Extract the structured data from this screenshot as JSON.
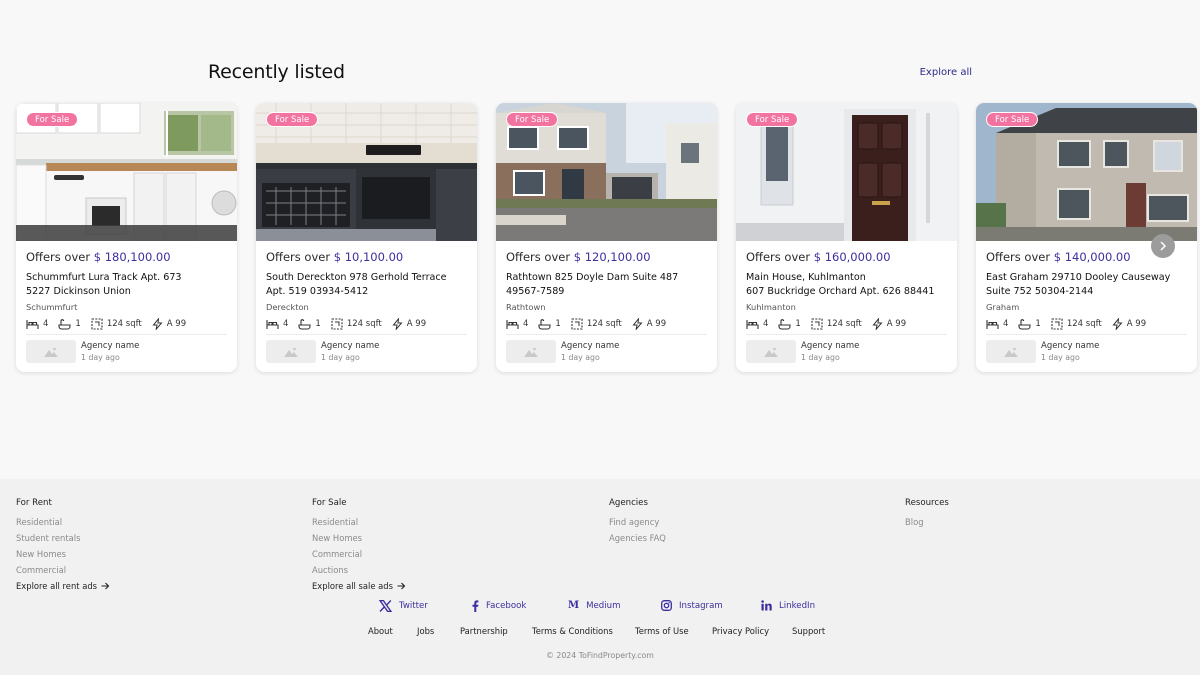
{
  "section": {
    "title": "Recently listed",
    "explore_label": "Explore all"
  },
  "listings": [
    {
      "badge": "For Sale",
      "price_prefix": "Offers over",
      "price": "$ 180,100.00",
      "address_line1": "Schummfurt Lura Track Apt. 673",
      "address_line2": "5227 Dickinson Union",
      "town": "Schummfurt",
      "beds": "4",
      "baths": "1",
      "area": "124 sqft",
      "energy": "A 99",
      "agency_name": "Agency name",
      "listed": "1 day ago"
    },
    {
      "badge": "For Sale",
      "price_prefix": "Offers over",
      "price": "$ 10,100.00",
      "address_line1": "South Dereckton 978 Gerhold Terrace",
      "address_line2": "Apt. 519 03934-5412",
      "town": "Dereckton",
      "beds": "4",
      "baths": "1",
      "area": "124 sqft",
      "energy": "A 99",
      "agency_name": "Agency name",
      "listed": "1 day ago"
    },
    {
      "badge": "For Sale",
      "price_prefix": "Offers over",
      "price": "$ 120,100.00",
      "address_line1": "Rathtown 825 Doyle Dam Suite 487",
      "address_line2": "49567-7589",
      "town": "Rathtown",
      "beds": "4",
      "baths": "1",
      "area": "124 sqft",
      "energy": "A 99",
      "agency_name": "Agency name",
      "listed": "1 day ago"
    },
    {
      "badge": "For Sale",
      "price_prefix": "Offers over",
      "price": "$ 160,000.00",
      "address_line1": "Main House, Kuhlmanton",
      "address_line2": "607 Buckridge Orchard Apt. 626 88441",
      "town": "Kuhlmanton",
      "beds": "4",
      "baths": "1",
      "area": "124 sqft",
      "energy": "A 99",
      "agency_name": "Agency name",
      "listed": "1 day ago"
    },
    {
      "badge": "For Sale",
      "price_prefix": "Offers over",
      "price": "$ 140,000.00",
      "address_line1": "East Graham 29710 Dooley Causeway",
      "address_line2": "Suite 752 50304-2144",
      "town": "Graham",
      "beds": "4",
      "baths": "1",
      "area": "124 sqft",
      "energy": "A 99",
      "agency_name": "Agency name",
      "listed": "1 day ago"
    }
  ],
  "footer": {
    "for_rent": {
      "heading": "For Rent",
      "links": [
        "Residential",
        "Student rentals",
        "New Homes",
        "Commercial"
      ],
      "explore": "Explore all rent ads"
    },
    "for_sale": {
      "heading": "For Sale",
      "links": [
        "Residential",
        "New Homes",
        "Commercial",
        "Auctions"
      ],
      "explore": "Explore all sale ads"
    },
    "agencies": {
      "heading": "Agencies",
      "links": [
        "Find agency",
        "Agencies FAQ"
      ]
    },
    "resources": {
      "heading": "Resources",
      "links": [
        "Blog"
      ]
    },
    "socials": [
      {
        "label": "Twitter",
        "icon": "x-twitter-icon"
      },
      {
        "label": "Facebook",
        "icon": "facebook-icon"
      },
      {
        "label": "Medium",
        "icon": "medium-icon"
      },
      {
        "label": "Instagram",
        "icon": "instagram-icon"
      },
      {
        "label": "LinkedIn",
        "icon": "linkedin-icon"
      }
    ],
    "legal": [
      "About",
      "Jobs",
      "Partnership",
      "Terms & Conditions",
      "Terms of Use",
      "Privacy Policy",
      "Support"
    ],
    "copyright": "© 2024 ToFindProperty.com"
  },
  "colors": {
    "accent": "#3b2f9e",
    "badge": "#f2739f",
    "footer_bg": "#f1f1f1"
  }
}
